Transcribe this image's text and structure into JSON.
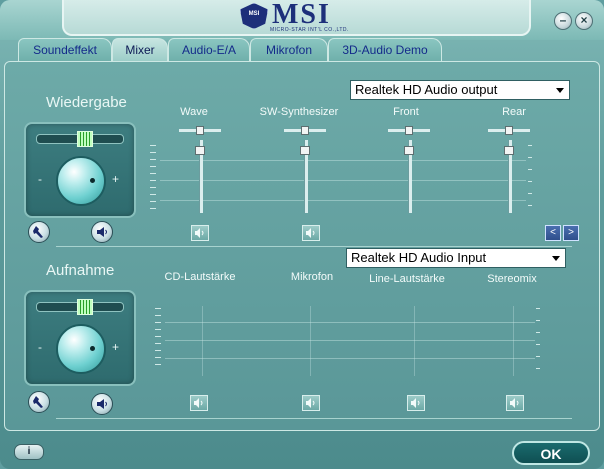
{
  "brand": {
    "name": "MSI",
    "shield_text": "MSI",
    "tagline": "MICRO-STAR INT'L CO.,LTD."
  },
  "window_buttons": {
    "minimize": "–",
    "close": "×"
  },
  "tabs": [
    {
      "label": "Soundeffekt",
      "active": false
    },
    {
      "label": "Mixer",
      "active": true
    },
    {
      "label": "Audio-E/A",
      "active": false
    },
    {
      "label": "Mikrofon",
      "active": false
    },
    {
      "label": "3D-Audio Demo",
      "active": false
    }
  ],
  "playback": {
    "title": "Wiedergabe",
    "device": "Realtek HD Audio output",
    "master_volume_level": 0.55,
    "minus": "-",
    "plus": "+",
    "channels": [
      {
        "label": "Wave",
        "level": 0.9,
        "balance": 0.5
      },
      {
        "label": "SW-Synthesizer",
        "level": 0.9,
        "balance": 0.5
      },
      {
        "label": "Front",
        "level": 0.9,
        "balance": 0.5
      },
      {
        "label": "Rear",
        "level": 0.9,
        "balance": 0.5
      }
    ],
    "nav_prev": "<",
    "nav_next": ">"
  },
  "recording": {
    "title": "Aufnahme",
    "device": "Realtek HD Audio Input",
    "master_volume_level": 0.55,
    "minus": "-",
    "plus": "+",
    "channels": [
      {
        "label": "CD-Lautstärke"
      },
      {
        "label": "Mikrofon"
      },
      {
        "label": "Line-Lautstärke"
      },
      {
        "label": "Stereomix"
      }
    ]
  },
  "footer": {
    "info_label": "i",
    "ok_label": "OK"
  },
  "colors": {
    "accent": "#1d2f7a",
    "panel": "#5f9ea0",
    "tab_text": "#142a8a"
  }
}
